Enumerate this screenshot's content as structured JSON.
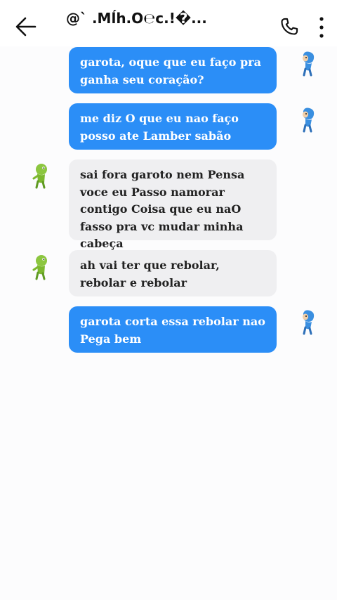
{
  "header": {
    "title": "@` .Mĺh.O℮c.!�..."
  },
  "messages": [
    {
      "direction": "outgoing",
      "text": "garota, oque que eu faço pra ganha seu coração?"
    },
    {
      "direction": "outgoing",
      "text": "me diz O que eu nao faço posso ate Lamber sabão"
    },
    {
      "direction": "incoming",
      "text": "sai fora garoto nem Pensa voce eu Passo namorar contigo Coisa que eu naO fasso pra vc mudar minha cabeça"
    },
    {
      "direction": "incoming",
      "text": "ah vai ter que rebolar, rebolar e rebolar"
    },
    {
      "direction": "outgoing",
      "text": "garota corta essa rebolar nao Pega bem"
    }
  ],
  "icons": {
    "back": "arrow-left-icon",
    "call": "phone-icon",
    "more": "more-vertical-icon",
    "outgoing_avatar": "blue-character-avatar",
    "incoming_avatar": "green-character-avatar"
  },
  "colors": {
    "outgoing_bubble": "#2b8ef7",
    "incoming_bubble": "#efeff1",
    "background": "#fcfcfd"
  }
}
